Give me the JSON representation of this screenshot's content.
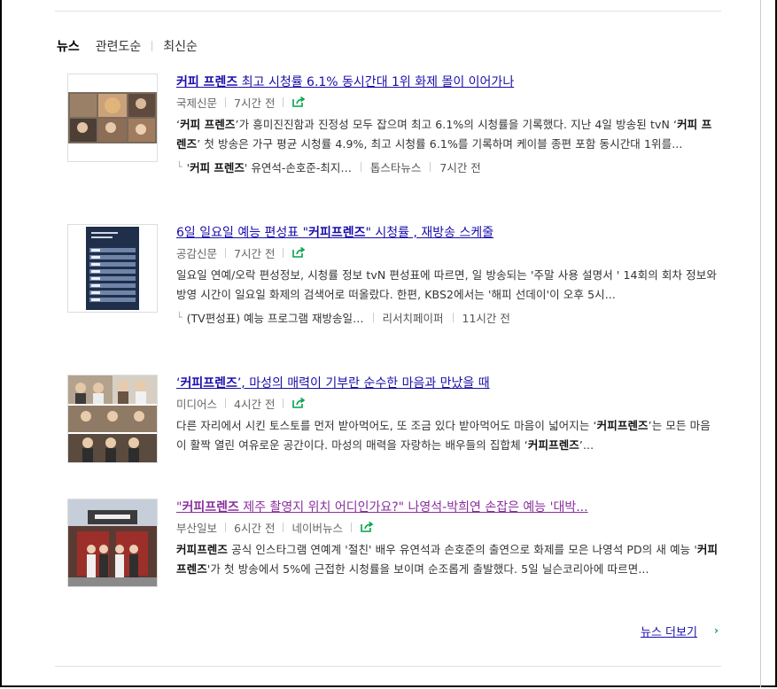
{
  "tabs": [
    {
      "label": "뉴스",
      "active": true
    },
    {
      "label": "관련도순",
      "active": false
    },
    {
      "label": "최신순",
      "active": false
    }
  ],
  "articles": [
    {
      "title_pre": "",
      "title_bold": "커피 프렌즈",
      "title_post": " 최고 시청률 6.1% 동시간대 1위 화제 몰이 이어가나",
      "source": "국제신문",
      "time": "7시간 전",
      "extra_source": "",
      "desc_parts": [
        "‘",
        "커피 프렌즈",
        "’가 흥미진진함과 진정성 모두 잡으며 최고 6.1%의 시청률을 기록했다. 지난 4일 방송된 tvN ‘",
        "커피 프렌즈",
        "’ 첫 방송은 가구 평균 시청률 4.9%, 최고 시청률 6.1%를 기록하며 케이블 종편 포함 동시간대 1위를..."
      ],
      "related": {
        "pre": "'",
        "bold": "커피 프렌즈",
        "post": "' 유연석-손호준-최지…",
        "source": "톱스타뉴스",
        "time": "7시간 전"
      }
    },
    {
      "title_pre": "6일 일요일 예능 편성표 \"",
      "title_bold": "커피프렌즈",
      "title_post": "\" 시청률 , 재방송 스케줄",
      "source": "공감신문",
      "time": "7시간 전",
      "extra_source": "",
      "desc_parts": [
        "일요일 연예/오락 편성정보, 시청률 정보 tvN 편성표에 따르면, 일 방송되는 '주말 사용 설명서 ' 14회의 회차 정보와 방영 시간이 일요일 화제의 검색어로 떠올랐다. 한편, KBS2에서는 '해피 선데이'이 오후 5시..."
      ],
      "related": {
        "pre": "(TV편성표) 예능 프로그램 재방송일…",
        "bold": "",
        "post": "",
        "source": "리서치페이퍼",
        "time": "11시간 전"
      }
    },
    {
      "title_pre": "‘",
      "title_bold": "커피프렌즈",
      "title_post": "’, 마성의 매력이 기부란 순수한 마음과 만났을 때",
      "source": "미디어스",
      "time": "4시간 전",
      "extra_source": "",
      "desc_parts": [
        "다른 자리에서 시킨 토스토를 먼저 받아먹어도, 또 조금 있다 받아먹어도 마음이 넓어지는 ‘",
        "커피프렌즈",
        "’는 모든 마음이 활짝 열린 여유로운 공간이다. 마성의 매력을 자랑하는 배우들의 집합체 ‘",
        "커피프렌즈",
        "’..."
      ],
      "related": null
    },
    {
      "title_pre": "\"",
      "title_bold": "커피프렌즈",
      "title_post": " 제주 촬영지 위치 어디인가요?\" 나영석-박희연 손잡은 예능 '대박...",
      "source": "부산일보",
      "time": "6시간 전",
      "extra_source": "네이버뉴스",
      "desc_parts": [
        "",
        "커피프렌즈",
        " 공식 인스타그램 연예계 '절친' 배우 유연석과 손호준의 출연으로 화제를 모은 나영석 PD의 새 예능 '",
        "커피프렌즈",
        "'가 첫 방송에서 5%에 근접한 시청률을 보이며 순조롭게 출발했다. 5일 닐슨코리아에 따르면..."
      ],
      "related": null
    }
  ],
  "more_label": "뉴스 더보기",
  "colors": {
    "link": "#1a0dab",
    "visited": "#8a2f9c",
    "share": "#03a34a"
  }
}
